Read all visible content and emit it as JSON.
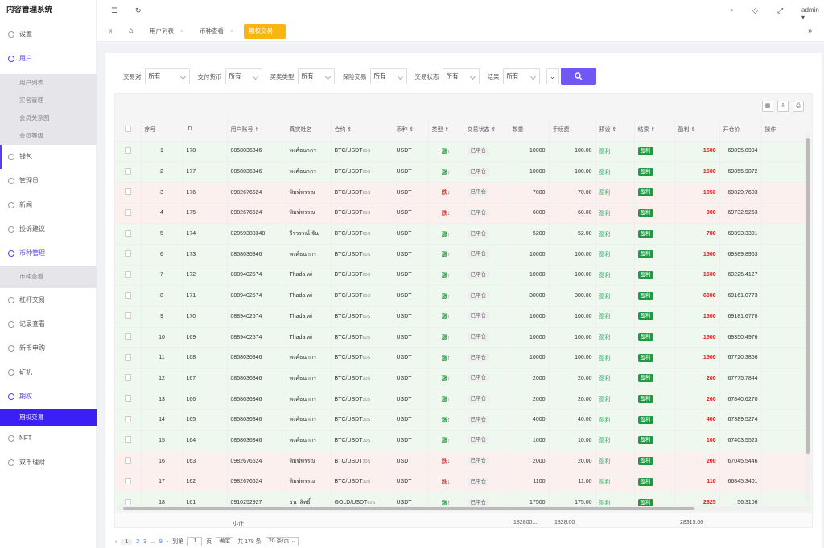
{
  "app": {
    "title": "内容管理系统",
    "user": "admin"
  },
  "sidebar": {
    "items": [
      {
        "label": "设置",
        "icon": "gear-icon"
      },
      {
        "label": "用户",
        "icon": "user-icon"
      },
      {
        "label": "钱包",
        "icon": "wallet-icon"
      },
      {
        "label": "管理员",
        "icon": "shield-icon"
      },
      {
        "label": "新闻",
        "icon": "news-icon"
      },
      {
        "label": "投诉建议",
        "icon": "complaint-icon"
      },
      {
        "label": "币种管理",
        "icon": "coin-icon"
      },
      {
        "label": "杠杆交易",
        "icon": "leverage-icon"
      },
      {
        "label": "记录查看",
        "icon": "record-icon"
      },
      {
        "label": "新币申购",
        "icon": "newcoin-icon"
      },
      {
        "label": "矿机",
        "icon": "miner-icon"
      },
      {
        "label": "期权",
        "icon": "option-icon"
      },
      {
        "label": "NFT",
        "icon": "nft-icon"
      },
      {
        "label": "双币理财",
        "icon": "finance-icon"
      }
    ],
    "user_sub": [
      "用户列表",
      "实名管理",
      "会员关系图",
      "会员等级"
    ],
    "coin_sub": [
      "币种查看"
    ],
    "option_sub": [
      "期权交易"
    ]
  },
  "tabs": [
    {
      "label": "用户列表"
    },
    {
      "label": "币种查看"
    },
    {
      "label": "期权交易"
    }
  ],
  "filters": [
    {
      "label": "交易对",
      "value": "所有"
    },
    {
      "label": "支付货币",
      "value": "所有"
    },
    {
      "label": "买卖类型",
      "value": "所有"
    },
    {
      "label": "保险交易",
      "value": "所有"
    },
    {
      "label": "交易状态",
      "value": "所有"
    },
    {
      "label": "结果",
      "value": "所有"
    }
  ],
  "table": {
    "headers": [
      "序号",
      "ID",
      "用户账号",
      "真实姓名",
      "合约",
      "币种",
      "类型",
      "交易状态",
      "数量",
      "手续费",
      "预设",
      "结果",
      "盈利",
      "开仓价",
      "操作"
    ],
    "rows": [
      {
        "no": "1",
        "id": "178",
        "acct": "0858036346",
        "name": "พงศ์ธนากร",
        "pair": "BTC/USDT",
        "sec": "60S",
        "coin": "USDT",
        "type": "涨↑",
        "dir": "up",
        "status": "已平仓",
        "qty": "10000",
        "fee": "100.00",
        "preset": "盈利",
        "result": "盈利",
        "profit": "1500",
        "price": "69895.0984"
      },
      {
        "no": "2",
        "id": "177",
        "acct": "0858036346",
        "name": "พงศ์ธนากร",
        "pair": "BTC/USDT",
        "sec": "60S",
        "coin": "USDT",
        "type": "涨↑",
        "dir": "up",
        "status": "已平仓",
        "qty": "10000",
        "fee": "100.00",
        "preset": "盈利",
        "result": "盈利",
        "profit": "1500",
        "price": "69855.9072"
      },
      {
        "no": "3",
        "id": "176",
        "acct": "0982676624",
        "name": "พิมพ์พรรณ",
        "pair": "BTC/USDT",
        "sec": "60S",
        "coin": "USDT",
        "type": "跌↓",
        "dir": "dn",
        "status": "已平仓",
        "qty": "7000",
        "fee": "70.00",
        "preset": "盈利",
        "result": "盈利",
        "profit": "1050",
        "price": "69829.7603"
      },
      {
        "no": "4",
        "id": "175",
        "acct": "0982676624",
        "name": "พิมพ์พรรณ",
        "pair": "BTC/USDT",
        "sec": "60S",
        "coin": "USDT",
        "type": "跌↓",
        "dir": "dn",
        "status": "已平仓",
        "qty": "6000",
        "fee": "60.00",
        "preset": "盈利",
        "result": "盈利",
        "profit": "900",
        "price": "69732.5263"
      },
      {
        "no": "5",
        "id": "174",
        "acct": "02059388348",
        "name": "วีรวรรณ์ จัน",
        "pair": "BTC/USDT",
        "sec": "60S",
        "coin": "USDT",
        "type": "涨↑",
        "dir": "up",
        "status": "已平仓",
        "qty": "5200",
        "fee": "52.00",
        "preset": "盈利",
        "result": "盈利",
        "profit": "780",
        "price": "69393.3391"
      },
      {
        "no": "6",
        "id": "173",
        "acct": "0858036346",
        "name": "พงศ์ธนากร",
        "pair": "BTC/USDT",
        "sec": "60S",
        "coin": "USDT",
        "type": "涨↑",
        "dir": "up",
        "status": "已平仓",
        "qty": "10000",
        "fee": "100.00",
        "preset": "盈利",
        "result": "盈利",
        "profit": "1500",
        "price": "69389.8963"
      },
      {
        "no": "7",
        "id": "172",
        "acct": "0889402574",
        "name": "Thada wi",
        "pair": "BTC/USDT",
        "sec": "60S",
        "coin": "USDT",
        "type": "涨↑",
        "dir": "up",
        "status": "已平仓",
        "qty": "10000",
        "fee": "100.00",
        "preset": "盈利",
        "result": "盈利",
        "profit": "1500",
        "price": "69225.4127"
      },
      {
        "no": "8",
        "id": "171",
        "acct": "0889402574",
        "name": "Thada wi",
        "pair": "BTC/USDT",
        "sec": "60S",
        "coin": "USDT",
        "type": "涨↑",
        "dir": "up",
        "status": "已平仓",
        "qty": "30000",
        "fee": "300.00",
        "preset": "盈利",
        "result": "盈利",
        "profit": "6000",
        "price": "69161.0773"
      },
      {
        "no": "9",
        "id": "170",
        "acct": "0889402574",
        "name": "Thada wi",
        "pair": "BTC/USDT",
        "sec": "60S",
        "coin": "USDT",
        "type": "涨↑",
        "dir": "up",
        "status": "已平仓",
        "qty": "10000",
        "fee": "100.00",
        "preset": "盈利",
        "result": "盈利",
        "profit": "1500",
        "price": "69181.6778"
      },
      {
        "no": "10",
        "id": "169",
        "acct": "0889402574",
        "name": "Thada wi",
        "pair": "BTC/USDT",
        "sec": "60S",
        "coin": "USDT",
        "type": "涨↑",
        "dir": "up",
        "status": "已平仓",
        "qty": "10000",
        "fee": "100.00",
        "preset": "盈利",
        "result": "盈利",
        "profit": "1500",
        "price": "69350.4976"
      },
      {
        "no": "11",
        "id": "168",
        "acct": "0858036346",
        "name": "พงศ์ธนากร",
        "pair": "BTC/USDT",
        "sec": "60S",
        "coin": "USDT",
        "type": "涨↑",
        "dir": "up",
        "status": "已平仓",
        "qty": "10000",
        "fee": "100.00",
        "preset": "盈利",
        "result": "盈利",
        "profit": "1500",
        "price": "67720.3866"
      },
      {
        "no": "12",
        "id": "167",
        "acct": "0858036346",
        "name": "พงศ์ธนากร",
        "pair": "BTC/USDT",
        "sec": "30S",
        "coin": "USDT",
        "type": "涨↑",
        "dir": "up",
        "status": "已平仓",
        "qty": "2000",
        "fee": "20.00",
        "preset": "盈利",
        "result": "盈利",
        "profit": "200",
        "price": "67775.7844"
      },
      {
        "no": "13",
        "id": "166",
        "acct": "0858036346",
        "name": "พงศ์ธนากร",
        "pair": "BTC/USDT",
        "sec": "30S",
        "coin": "USDT",
        "type": "涨↑",
        "dir": "up",
        "status": "已平仓",
        "qty": "2000",
        "fee": "20.00",
        "preset": "盈利",
        "result": "盈利",
        "profit": "200",
        "price": "67840.6270"
      },
      {
        "no": "14",
        "id": "165",
        "acct": "0858036346",
        "name": "พงศ์ธนากร",
        "pair": "BTC/USDT",
        "sec": "30S",
        "coin": "USDT",
        "type": "涨↑",
        "dir": "up",
        "status": "已平仓",
        "qty": "4000",
        "fee": "40.00",
        "preset": "盈利",
        "result": "盈利",
        "profit": "400",
        "price": "67389.5274"
      },
      {
        "no": "15",
        "id": "164",
        "acct": "0858036346",
        "name": "พงศ์ธนากร",
        "pair": "BTC/USDT",
        "sec": "30S",
        "coin": "USDT",
        "type": "涨↑",
        "dir": "up",
        "status": "已平仓",
        "qty": "1000",
        "fee": "10.00",
        "preset": "盈利",
        "result": "盈利",
        "profit": "100",
        "price": "67403.5523"
      },
      {
        "no": "16",
        "id": "163",
        "acct": "0982676624",
        "name": "พิมพ์พรรณ",
        "pair": "BTC/USDT",
        "sec": "30S",
        "coin": "USDT",
        "type": "跌↓",
        "dir": "dn",
        "status": "已平仓",
        "qty": "2000",
        "fee": "20.00",
        "preset": "盈利",
        "result": "盈利",
        "profit": "200",
        "price": "67045.5446"
      },
      {
        "no": "17",
        "id": "162",
        "acct": "0982676624",
        "name": "พิมพ์พรรณ",
        "pair": "BTC/USDT",
        "sec": "30S",
        "coin": "USDT",
        "type": "跌↓",
        "dir": "dn",
        "status": "已平仓",
        "qty": "1100",
        "fee": "11.00",
        "preset": "盈利",
        "result": "盈利",
        "profit": "110",
        "price": "66845.3401"
      },
      {
        "no": "18",
        "id": "161",
        "acct": "0910252927",
        "name": "ธนาสิทธิ์",
        "pair": "GOLD/USDT",
        "sec": "60S",
        "coin": "USDT",
        "type": "涨↑",
        "dir": "up",
        "status": "已平仓",
        "qty": "17500",
        "fee": "175.00",
        "preset": "盈利",
        "result": "盈利",
        "profit": "2625",
        "price": "56.3106"
      }
    ],
    "totals": {
      "label": "小计",
      "qty": "182800....",
      "fee": "1828.00",
      "profit": "28315.00"
    }
  },
  "pager": {
    "pages": [
      "1",
      "2",
      "3",
      "...",
      "9"
    ],
    "goto_label": "到第",
    "page_value": "1",
    "page_unit": "页",
    "confirm": "确定",
    "total": "共 178 条",
    "per_page": "20 条/页"
  }
}
